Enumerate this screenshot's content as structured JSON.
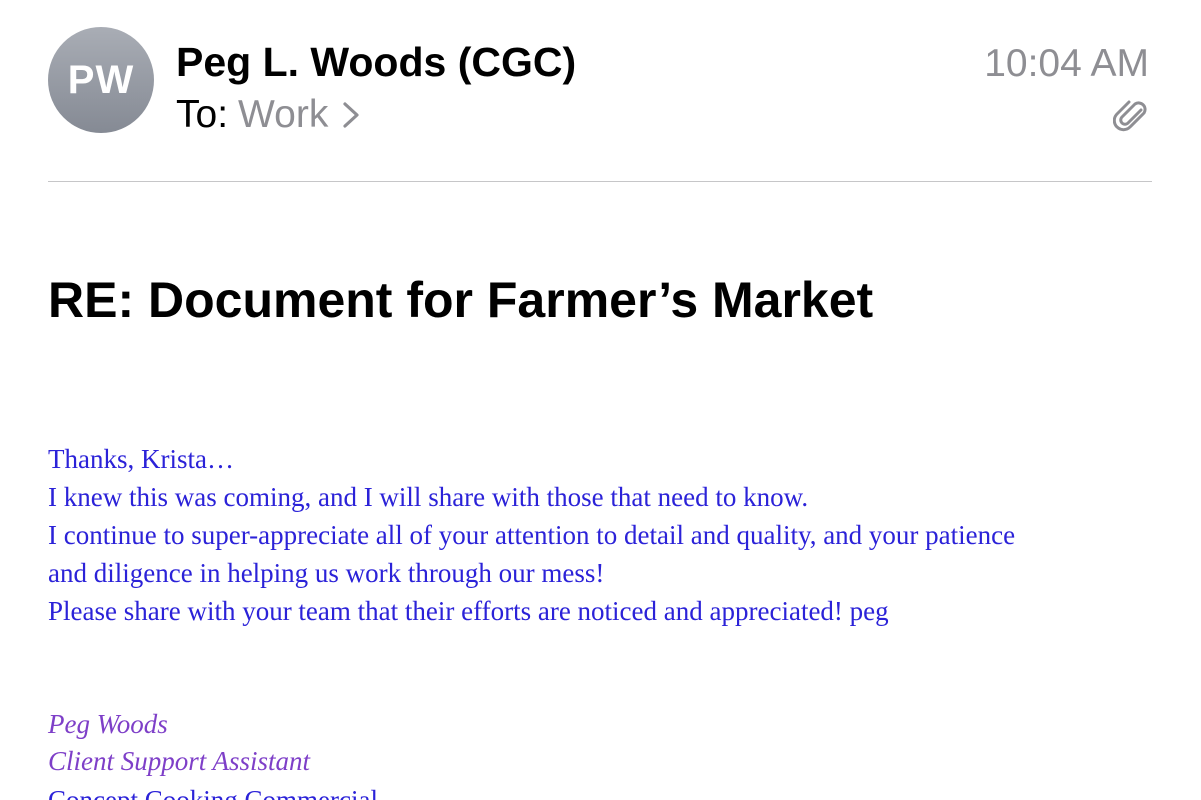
{
  "header": {
    "avatar_initials": "PW",
    "sender_name": "Peg L. Woods (CGC)",
    "to_label": "To:",
    "to_value": "Work",
    "time": "10:04 AM",
    "attachment_icon": "paperclip-icon",
    "chevron_icon": "chevron-right-icon"
  },
  "subject": "RE: Document for Farmer’s Market",
  "body": {
    "lines": [
      "Thanks, Krista…",
      "I knew this was coming, and I will share with those that need to know.",
      "I continue to super-appreciate all of your attention to detail and quality, and your patience",
      "and diligence in helping us work through our mess!",
      "Please share with your team that their efforts are noticed and appreciated!  peg"
    ]
  },
  "signature": {
    "name": "Peg Woods",
    "title": "Client Support Assistant",
    "partial_line": "Concept Cooking Commercial..."
  },
  "colors": {
    "body_text": "#2b22d8",
    "signature_text": "#7e3fc8",
    "secondary_gray": "#8e8e93",
    "avatar_gray": "#969aa3"
  }
}
